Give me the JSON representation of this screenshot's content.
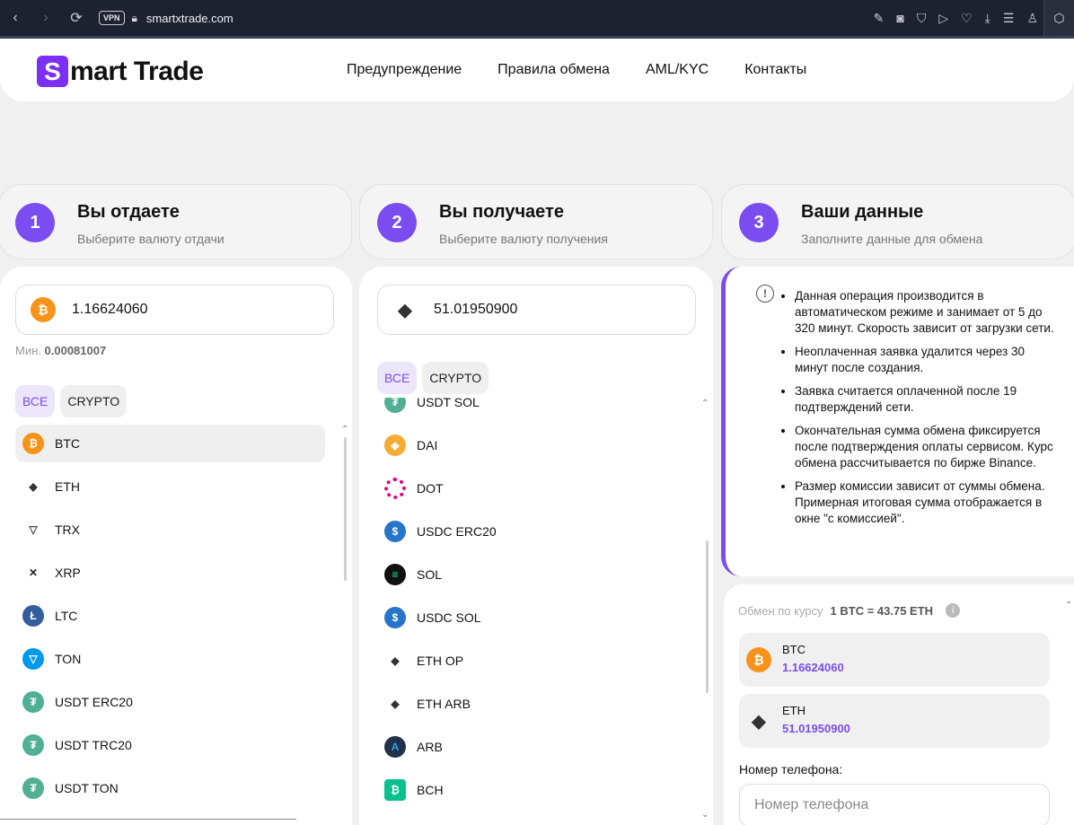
{
  "browser": {
    "back": "‹",
    "forward": "›",
    "reload": "⟳",
    "vpn": "VPN",
    "url": "smartxtrade.com"
  },
  "header": {
    "logo_letter": "S",
    "logo_text": "mart Trade",
    "nav": [
      "Предупреждение",
      "Правила обмена",
      "AML/KYC",
      "Контакты"
    ]
  },
  "steps": [
    {
      "num": "1",
      "title": "Вы отдаете",
      "subtitle": "Выберите валюту отдачи"
    },
    {
      "num": "2",
      "title": "Вы получаете",
      "subtitle": "Выберите валюту получения"
    },
    {
      "num": "3",
      "title": "Ваши данные",
      "subtitle": "Заполните данные для обмена"
    }
  ],
  "give": {
    "amount": "1.16624060",
    "min_label": "Мин.",
    "min_value": "0.00081007",
    "filters": [
      "ВСЕ",
      "CRYPTO"
    ],
    "coins": [
      {
        "name": "BTC",
        "icon": "bitcoin-icon",
        "glyph": "₿",
        "cls": "c-btc"
      },
      {
        "name": "ETH",
        "icon": "ethereum-icon",
        "glyph": "◆",
        "cls": "c-eth"
      },
      {
        "name": "TRX",
        "icon": "tron-icon",
        "glyph": "▽",
        "cls": "c-trx"
      },
      {
        "name": "XRP",
        "icon": "xrp-icon",
        "glyph": "✕",
        "cls": "c-xrp"
      },
      {
        "name": "LTC",
        "icon": "litecoin-icon",
        "glyph": "Ł",
        "cls": "c-ltc"
      },
      {
        "name": "TON",
        "icon": "ton-icon",
        "glyph": "▽",
        "cls": "c-ton"
      },
      {
        "name": "USDT ERC20",
        "icon": "tether-icon",
        "glyph": "₮",
        "cls": "c-usdt"
      },
      {
        "name": "USDT TRC20",
        "icon": "tether-icon",
        "glyph": "₮",
        "cls": "c-usdt"
      },
      {
        "name": "USDT TON",
        "icon": "tether-icon",
        "glyph": "₮",
        "cls": "c-usdt"
      }
    ]
  },
  "receive": {
    "amount": "51.01950900",
    "filters": [
      "ВСЕ",
      "CRYPTO"
    ],
    "coins": [
      {
        "name": "USDT SOL",
        "icon": "tether-icon",
        "glyph": "₮",
        "cls": "c-usdt"
      },
      {
        "name": "DAI",
        "icon": "dai-icon",
        "glyph": "◈",
        "cls": "c-dai"
      },
      {
        "name": "DOT",
        "icon": "polkadot-icon",
        "glyph": "",
        "cls": "c-dot"
      },
      {
        "name": "USDC ERC20",
        "icon": "usdc-icon",
        "glyph": "$",
        "cls": "c-usdc"
      },
      {
        "name": "SOL",
        "icon": "solana-icon",
        "glyph": "≡",
        "cls": "c-sol"
      },
      {
        "name": "USDC SOL",
        "icon": "usdc-icon",
        "glyph": "$",
        "cls": "c-usdc"
      },
      {
        "name": "ETH OP",
        "icon": "ethereum-icon",
        "glyph": "◆",
        "cls": "c-eth"
      },
      {
        "name": "ETH ARB",
        "icon": "ethereum-icon",
        "glyph": "◆",
        "cls": "c-eth"
      },
      {
        "name": "ARB",
        "icon": "arbitrum-icon",
        "glyph": "A",
        "cls": "c-arb"
      },
      {
        "name": "BCH",
        "icon": "bitcoin-cash-icon",
        "glyph": "₿",
        "cls": "c-bch"
      }
    ]
  },
  "info": {
    "icon": "!",
    "items": [
      "Данная операция производится в автоматическом режиме и занимает от 5 до 320 минут. Скорость зависит от загрузки сети.",
      "Неоплаченная заявка удалится через 30 минут после создания.",
      "Заявка считается оплаченной после 19 подтверждений сети.",
      "Окончательная сумма обмена фиксируется после подтверждения оплаты сервисом. Курс обмена рассчитывается по бирже Binance.",
      "Размер комиссии зависит от суммы обмена. Примерная итоговая сумма отображается в окне \"с комиссией\"."
    ]
  },
  "summary": {
    "rate_label": "Обмен по курсу",
    "rate_value": "1 BTC = 43.75 ETH",
    "from": {
      "name": "BTC",
      "value": "1.16624060"
    },
    "to": {
      "name": "ETH",
      "value": "51.01950900"
    },
    "phone_label": "Номер телефона:",
    "phone_placeholder": "Номер телефона"
  }
}
